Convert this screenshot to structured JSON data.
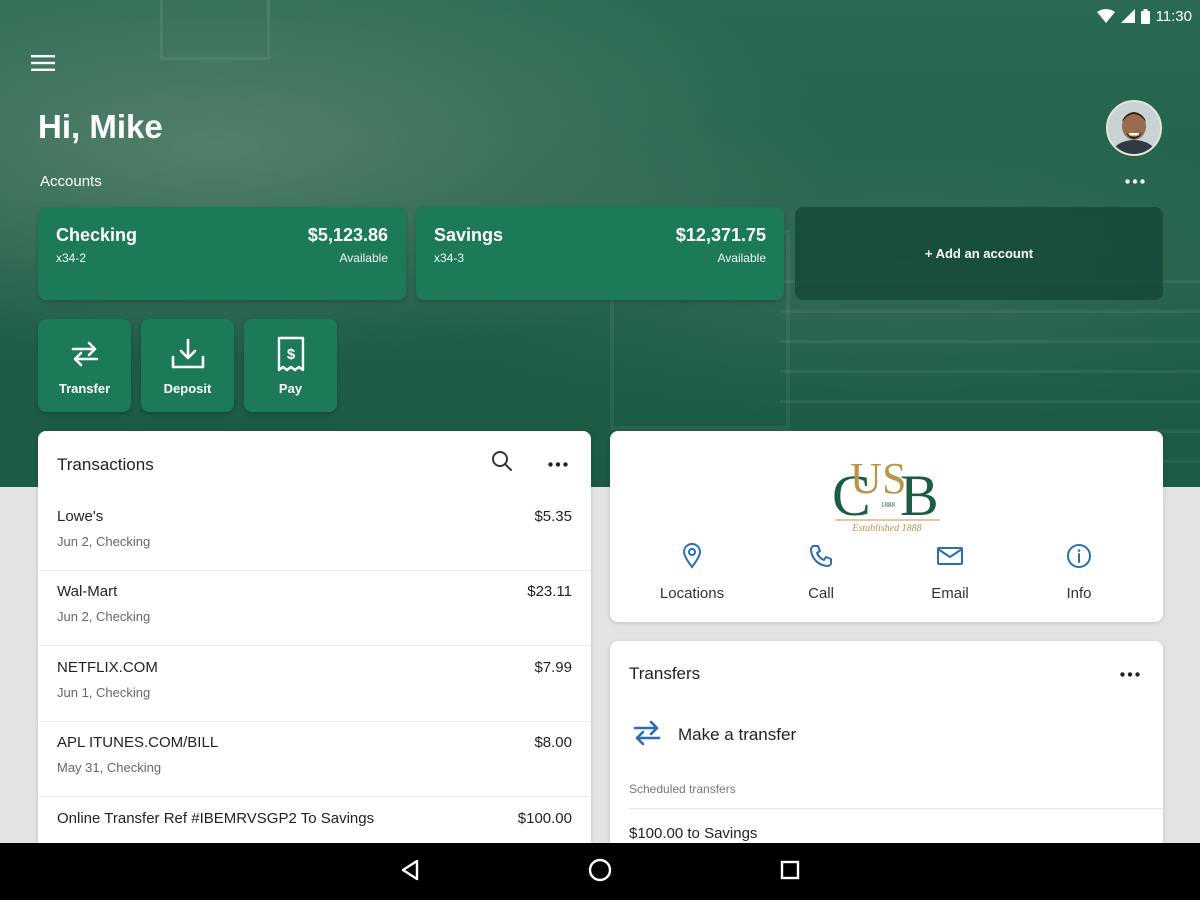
{
  "status_bar": {
    "time": "11:30"
  },
  "header": {
    "greeting": "Hi, Mike",
    "accounts_label": "Accounts"
  },
  "accounts": [
    {
      "name": "Checking",
      "number": "x34-2",
      "balance": "$5,123.86",
      "balance_label": "Available"
    },
    {
      "name": "Savings",
      "number": "x34-3",
      "balance": "$12,371.75",
      "balance_label": "Available"
    }
  ],
  "add_account_label": "+ Add an account",
  "actions": [
    {
      "label": "Transfer",
      "icon": "transfer-icon"
    },
    {
      "label": "Deposit",
      "icon": "deposit-icon"
    },
    {
      "label": "Pay",
      "icon": "pay-icon"
    }
  ],
  "transactions": {
    "title": "Transactions",
    "items": [
      {
        "merchant": "Lowe's",
        "meta": "Jun 2, Checking",
        "amount": "$5.35"
      },
      {
        "merchant": "Wal-Mart",
        "meta": "Jun 2, Checking",
        "amount": "$23.11"
      },
      {
        "merchant": "NETFLIX.COM",
        "meta": "Jun 1, Checking",
        "amount": "$7.99"
      },
      {
        "merchant": "APL ITUNES.COM/BILL",
        "meta": "May 31, Checking",
        "amount": "$8.00"
      },
      {
        "merchant": "Online Transfer Ref #IBEMRVSGP2 To Savings",
        "meta": "",
        "amount": "$100.00"
      }
    ]
  },
  "bank": {
    "logo_letters": "CUSB",
    "logo_year": "1888",
    "logo_tagline": "Established 1888",
    "contacts": [
      {
        "label": "Locations",
        "icon": "location-pin-icon"
      },
      {
        "label": "Call",
        "icon": "phone-icon"
      },
      {
        "label": "Email",
        "icon": "email-icon"
      },
      {
        "label": "Info",
        "icon": "info-icon"
      }
    ]
  },
  "transfers": {
    "title": "Transfers",
    "make_transfer_label": "Make a transfer",
    "scheduled_label": "Scheduled transfers",
    "scheduled_items": [
      "$100.00 to Savings"
    ]
  },
  "colors": {
    "brand_green": "#1f5e47",
    "card_green": "#1d7a56",
    "accent_blue": "#2a6db0",
    "logo_gold": "#b8954a",
    "logo_green": "#1c5c45"
  }
}
